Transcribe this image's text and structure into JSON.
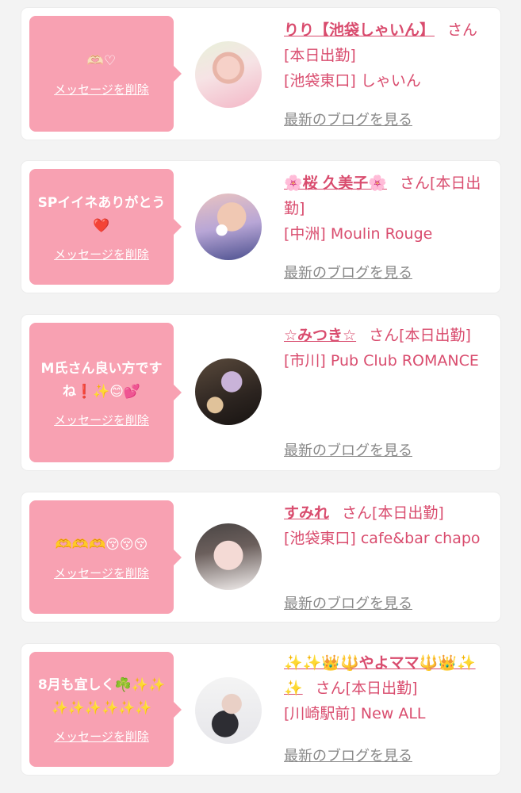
{
  "cards": [
    {
      "message": "🫶🏻♡",
      "delete_label": "メッセージを削除",
      "name": "りり【池袋しゃいん】",
      "status": "さん[本日出勤]",
      "location": "[池袋東口] しゃいん",
      "blog_label": "最新のブログを見る"
    },
    {
      "message": "SPイイネありがとう❤️",
      "delete_label": "メッセージを削除",
      "name": "🌸桜 久美子🌸",
      "status": "さん[本日出勤]",
      "location": "[中洲] Moulin Rouge",
      "blog_label": "最新のブログを見る"
    },
    {
      "message": "M氏さん良い方ですね❗️✨😊💕",
      "delete_label": "メッセージを削除",
      "name": "☆みつき☆",
      "status": "さん[本日出勤]",
      "location": "[市川] Pub Club ROMANCE",
      "blog_label": "最新のブログを見る"
    },
    {
      "message": "🫶🫶🫶😚😚😚",
      "delete_label": "メッセージを削除",
      "name": "すみれ",
      "status": "さん[本日出勤]",
      "location": "[池袋東口] cafe&bar chapo",
      "blog_label": "最新のブログを見る"
    },
    {
      "message": "8月も宜しく☘️✨✨✨✨✨✨✨✨",
      "delete_label": "メッセージを削除",
      "name": "✨✨👑🔱やよママ🔱👑✨✨",
      "status": "さん[本日出勤]",
      "location": "[川崎駅前] New ALL",
      "blog_label": "最新のブログを見る"
    }
  ]
}
